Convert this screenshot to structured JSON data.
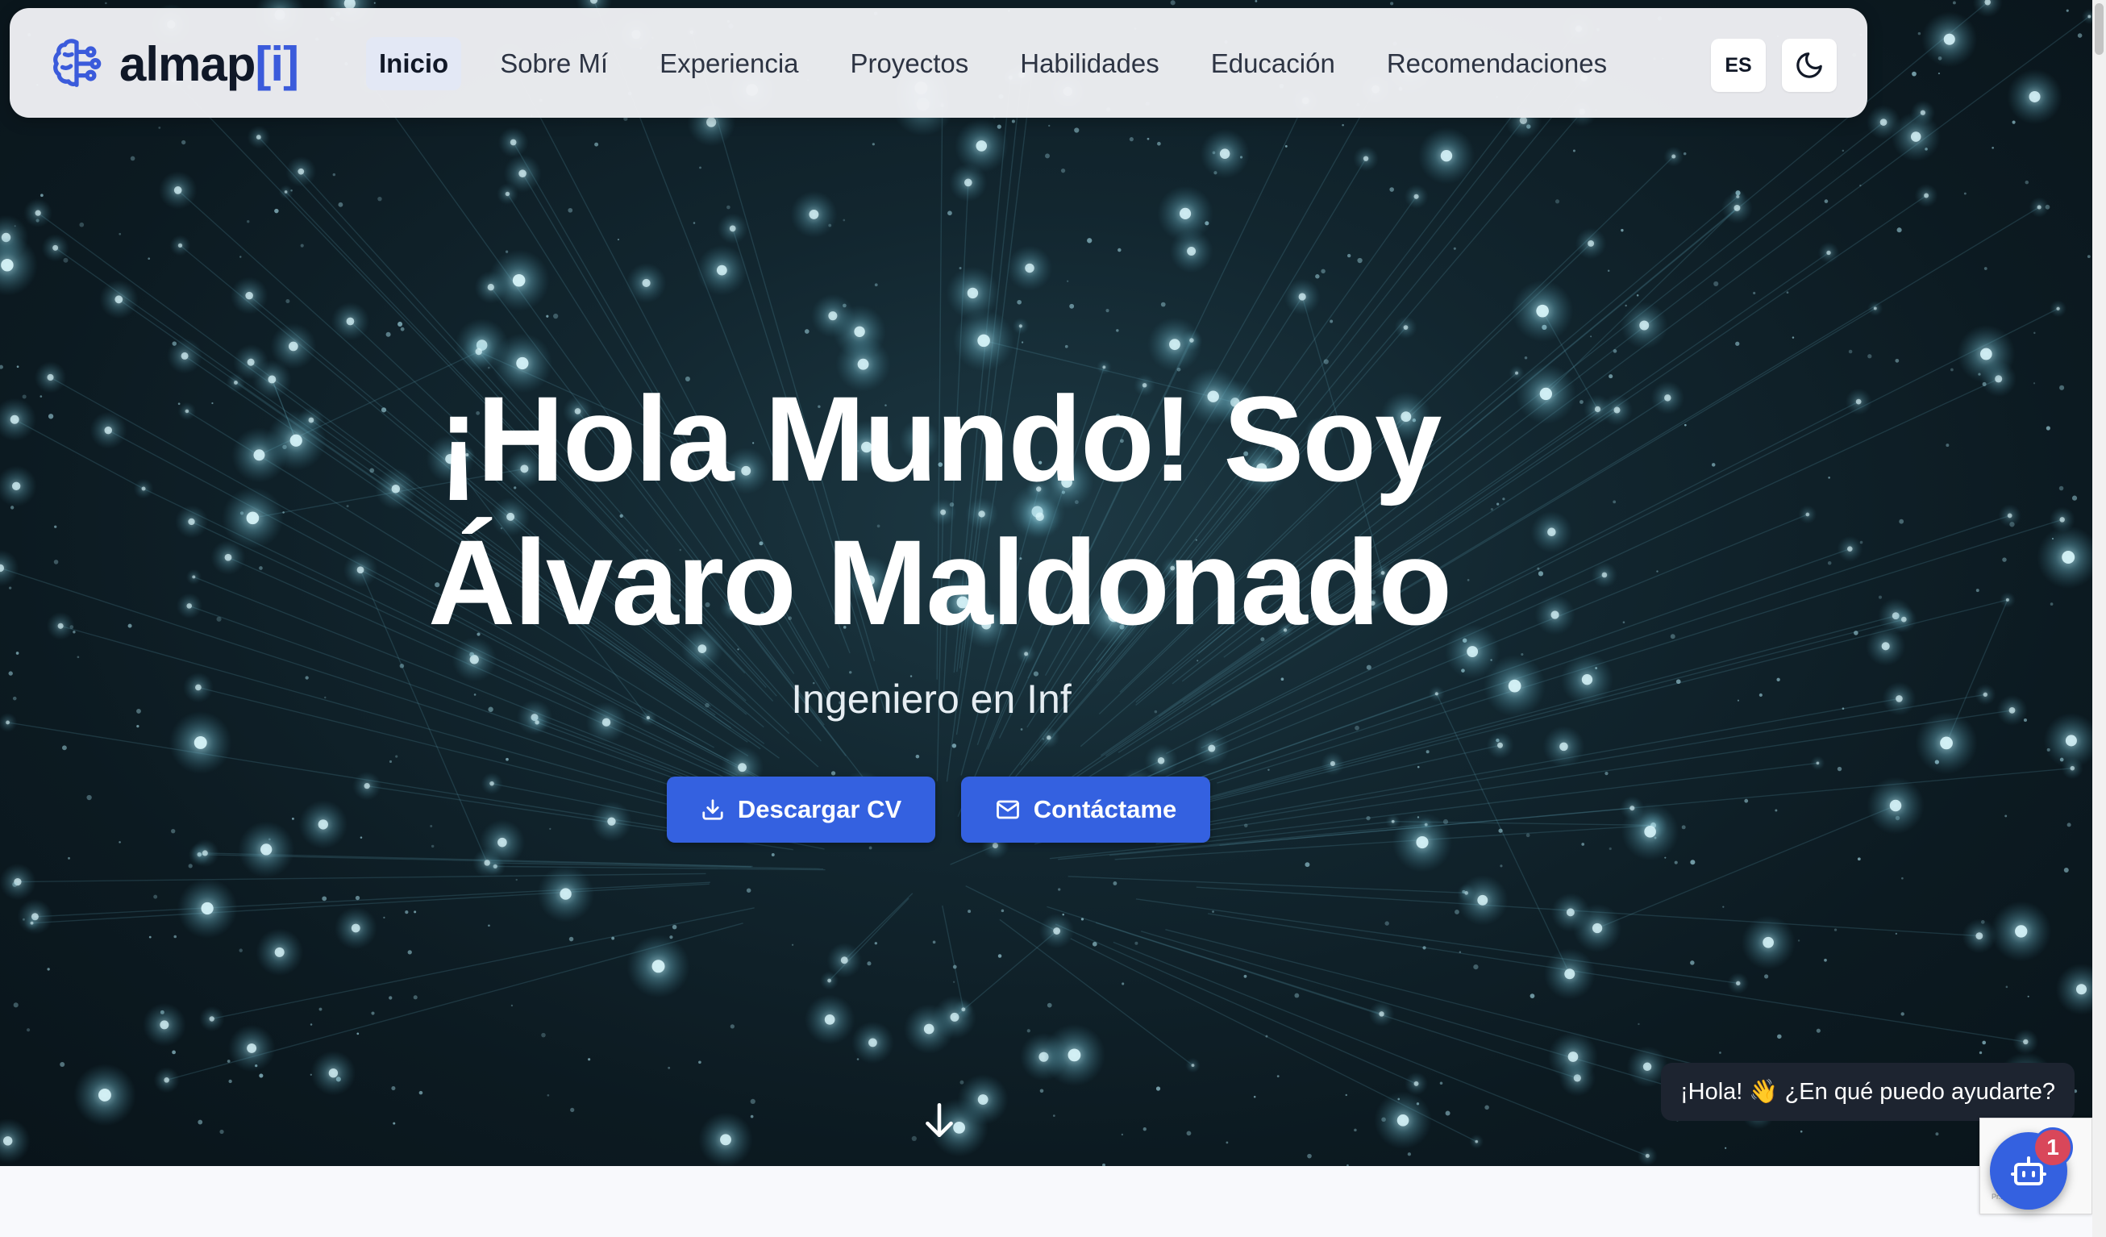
{
  "brand": {
    "name": "almap",
    "accent": "[i]"
  },
  "nav": {
    "items": [
      "Inicio",
      "Sobre Mí",
      "Experiencia",
      "Proyectos",
      "Habilidades",
      "Educación",
      "Recomendaciones"
    ],
    "active": "Inicio"
  },
  "controls": {
    "language": "ES",
    "theme_icon": "moon-icon"
  },
  "hero": {
    "title_line1": "¡Hola Mundo! Soy",
    "title_line2": "Álvaro Maldonado",
    "subtitle": "Ingeniero en Inf",
    "download_label": "Descargar CV",
    "contact_label": "Contáctame"
  },
  "chat": {
    "greeting": "¡Hola! 👋 ¿En qué puedo ayudarte?",
    "badge_count": "1"
  },
  "colors": {
    "accent": "#3461e0",
    "brand_accent": "#3b5bdb",
    "hero_bg": "#0c1a21",
    "badge": "#d9475a"
  }
}
